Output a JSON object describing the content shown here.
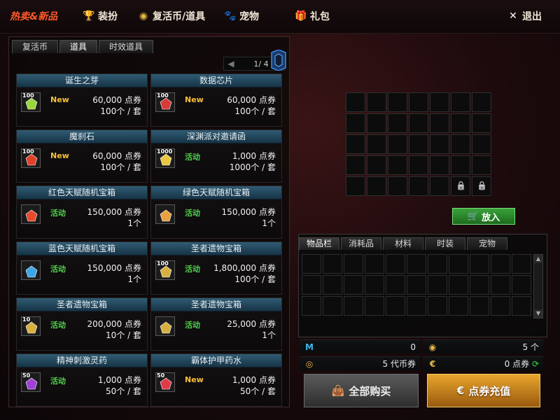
{
  "nav": {
    "hot": "热卖&新品",
    "dress": "装扮",
    "coin": "复活币/道具",
    "pet": "宠物",
    "gift": "礼包",
    "exit": "退出"
  },
  "shop_tabs": [
    "复活币",
    "道具",
    "时效道具"
  ],
  "pager": "1/ 4",
  "items": [
    {
      "title": "诞生之芽",
      "count": "100",
      "tag": "New",
      "price": "60,000 点券",
      "qty": "100个 / 套",
      "color": "#9ad83a"
    },
    {
      "title": "数据芯片",
      "count": "100",
      "tag": "New",
      "price": "60,000 点券",
      "qty": "100个 / 套",
      "color": "#d83a3a"
    },
    {
      "title": "魔刹石",
      "count": "100",
      "tag": "New",
      "price": "60,000 点券",
      "qty": "100个 / 套",
      "color": "#e0402a"
    },
    {
      "title": "深渊派对邀请函",
      "count": "1000",
      "tag": "活动",
      "price": "1,000 点券",
      "qty": "1000个 / 套",
      "color": "#e8c840"
    },
    {
      "title": "红色天赋随机宝箱",
      "count": "",
      "tag": "活动",
      "price": "150,000 点券",
      "qty": "1个",
      "color": "#e84a2a"
    },
    {
      "title": "绿色天赋随机宝箱",
      "count": "",
      "tag": "活动",
      "price": "150,000 点券",
      "qty": "1个",
      "color": "#e8a040"
    },
    {
      "title": "蓝色天赋随机宝箱",
      "count": "",
      "tag": "活动",
      "price": "150,000 点券",
      "qty": "1个",
      "color": "#3aa8e8"
    },
    {
      "title": "圣者遗物宝箱",
      "count": "100",
      "tag": "活动",
      "price": "1,800,000 点券",
      "qty": "100个 / 套",
      "color": "#d8b040"
    },
    {
      "title": "圣者遗物宝箱",
      "count": "10",
      "tag": "活动",
      "price": "200,000 点券",
      "qty": "10个 / 套",
      "color": "#d8b040"
    },
    {
      "title": "圣者遗物宝箱",
      "count": "",
      "tag": "活动",
      "price": "25,000 点券",
      "qty": "1个",
      "color": "#d8b040"
    },
    {
      "title": "精神刺激灵药",
      "count": "50",
      "tag": "活动",
      "price": "1,000 点券",
      "qty": "50个 / 套",
      "color": "#a040d8"
    },
    {
      "title": "霸体护甲药水",
      "count": "50",
      "tag": "New",
      "price": "1,000 点券",
      "qty": "50个 / 套",
      "color": "#e03a4a"
    }
  ],
  "put_button": "放入",
  "inv_tabs": [
    "物品栏",
    "消耗品",
    "材料",
    "时装",
    "宠物"
  ],
  "currency": {
    "m_value": "0",
    "coin_value": "5 个",
    "daiquan_value": "5 代币券",
    "dianjuan_value": "0 点券"
  },
  "buy_all": "全部购买",
  "recharge": "点券充值",
  "colors": {
    "title_bar": "#2f5c74",
    "new_tag": "#f5c23a",
    "event_tag": "#4fd04a",
    "recharge": "#e8a52c"
  }
}
